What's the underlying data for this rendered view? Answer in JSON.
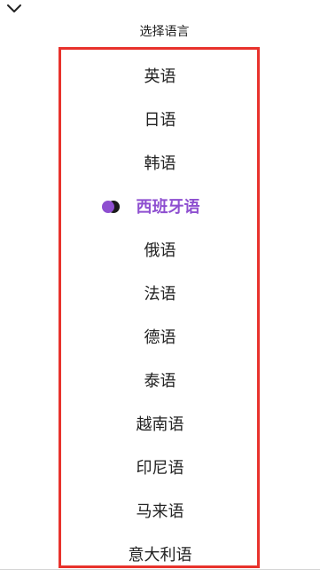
{
  "header": {
    "title": "选择语言",
    "back_icon": "chevron-down-icon"
  },
  "languages": [
    {
      "label": "英语",
      "selected": false
    },
    {
      "label": "日语",
      "selected": false
    },
    {
      "label": "韩语",
      "selected": false
    },
    {
      "label": "西班牙语",
      "selected": true
    },
    {
      "label": "俄语",
      "selected": false
    },
    {
      "label": "法语",
      "selected": false
    },
    {
      "label": "德语",
      "selected": false
    },
    {
      "label": "泰语",
      "selected": false
    },
    {
      "label": "越南语",
      "selected": false
    },
    {
      "label": "印尼语",
      "selected": false
    },
    {
      "label": "马来语",
      "selected": false
    },
    {
      "label": "意大利语",
      "selected": false
    }
  ],
  "colors": {
    "accent": "#8e4fd0",
    "accent_dark": "#1a1a1a",
    "frame": "#e8322c",
    "text": "#222222"
  }
}
